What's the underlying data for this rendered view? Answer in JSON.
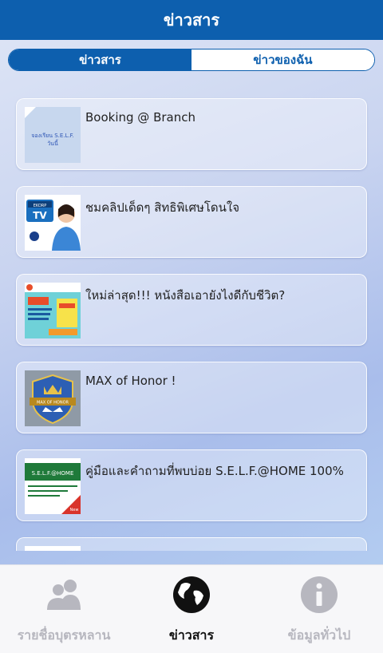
{
  "header": {
    "title": "ข่าวสาร"
  },
  "segment": {
    "tabs": [
      {
        "label": "ข่าวสาร",
        "active": true
      },
      {
        "label": "ข่าวของฉัน",
        "active": false
      }
    ]
  },
  "news": [
    {
      "title": "Booking @ Branch",
      "thumb_icon": "booking-thumbnail",
      "thumb_text": "จองเรียน S.E.L.F. วันนี้"
    },
    {
      "title": "ชมคลิปเด็ดๆ  สิทธิพิเศษโดนใจ",
      "thumb_icon": "tv-promo-thumbnail",
      "thumb_text": "EKORP TV"
    },
    {
      "title": "ใหม่ล่าสุด!!!  หนังสือเอายังไงดีกับชีวิต?",
      "thumb_icon": "book-cover-thumbnail",
      "thumb_text": ""
    },
    {
      "title": "MAX of Honor !",
      "thumb_icon": "shield-crown-thumbnail",
      "thumb_text": "MAX OF HONOR"
    },
    {
      "title": "คู่มือและคำถามที่พบบ่อย S.E.L.F.@HOME 100%",
      "thumb_icon": "self-home-thumbnail",
      "thumb_text": "S.E.L.F.@HOME"
    },
    {
      "title": "",
      "thumb_icon": "partial-thumbnail",
      "thumb_text": ""
    }
  ],
  "tabbar": {
    "items": [
      {
        "label": "รายชื่อบุตรหลาน",
        "icon": "people-icon",
        "active": false
      },
      {
        "label": "ข่าวสาร",
        "icon": "globe-icon",
        "active": true
      },
      {
        "label": "ข้อมูลทั่วไป",
        "icon": "info-icon",
        "active": false
      }
    ]
  },
  "colors": {
    "primary": "#0d5fae",
    "tab_inactive": "#b7b7bf",
    "tab_active": "#111111"
  }
}
